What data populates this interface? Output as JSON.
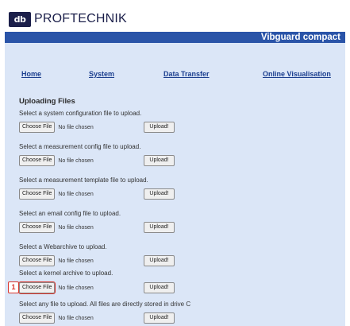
{
  "brand": {
    "logo_mark": "db",
    "name": "PROFTECHNIK"
  },
  "product": "Vibguard compact",
  "nav": [
    {
      "label": "Home"
    },
    {
      "label": "System"
    },
    {
      "label": "Data Transfer"
    },
    {
      "label": "Online Visualisation"
    }
  ],
  "section_title": "Uploading Files",
  "uploads": [
    {
      "label": "Select a system configuration file to upload.",
      "choose_label": "Choose File",
      "status": "No file chosen",
      "upload_label": "Upload!"
    },
    {
      "label": "Select a measurement config file to upload.",
      "choose_label": "Choose File",
      "status": "No file chosen",
      "upload_label": "Upload!"
    },
    {
      "label": "Select a measurement template file to upload.",
      "choose_label": "Choose File",
      "status": "No file chosen",
      "upload_label": "Upload!"
    },
    {
      "label": "Select an email config file to upload.",
      "choose_label": "Choose File",
      "status": "No file chosen",
      "upload_label": "Upload!"
    },
    {
      "label": "Select a Webarchive to upload.",
      "choose_label": "Choose File",
      "status": "No file chosen",
      "upload_label": "Upload!"
    },
    {
      "label": "Select a kernel archive to upload.",
      "choose_label": "Choose File",
      "status": "No file chosen",
      "upload_label": "Upload!"
    },
    {
      "label": "Select any file to upload. All files are directly stored in drive C",
      "choose_label": "Choose File",
      "status": "No file chosen",
      "upload_label": "Upload!"
    }
  ],
  "step_marker": "1",
  "colors": {
    "banner": "#2a54a8",
    "panel": "#dbe6f7",
    "link": "#1c3f8f",
    "marker": "#d9342b"
  }
}
